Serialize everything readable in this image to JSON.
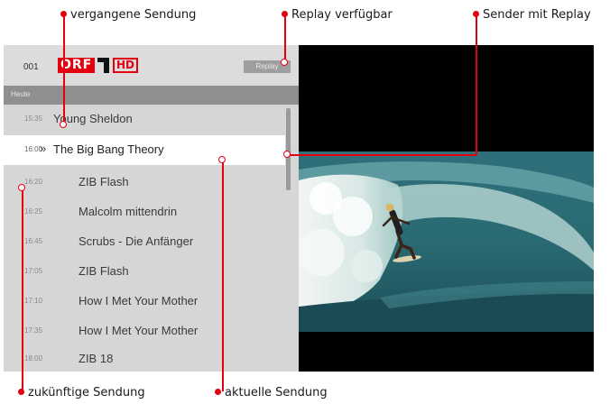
{
  "annotations": {
    "past": "vergangene Sendung",
    "replay": "Replay verfügbar",
    "channel_replay": "Sender mit Replay",
    "future": "zukünftige Sendung",
    "current": "aktuelle Sendung"
  },
  "channel": {
    "number": "001",
    "logo_text": "ORF",
    "hd_text": "HD",
    "replay_label": "Replay"
  },
  "day_label": "Heute",
  "programs": [
    {
      "time": "15:35",
      "title": "Young Sheldon"
    },
    {
      "time": "16:00",
      "title": "The Big Bang Theory"
    },
    {
      "time": "16:20",
      "title": "ZIB Flash"
    },
    {
      "time": "16:25",
      "title": "Malcolm mittendrin"
    },
    {
      "time": "16:45",
      "title": "Scrubs - Die Anfänger"
    },
    {
      "time": "17:05",
      "title": "ZIB Flash"
    },
    {
      "time": "17:10",
      "title": "How I Met Your Mother"
    },
    {
      "time": "17:35",
      "title": "How I Met Your Mother"
    },
    {
      "time": "18:00",
      "title": "ZIB 18"
    }
  ],
  "colors": {
    "accent": "#e3000f",
    "panel": "#d6d6d6",
    "current_row": "#ffffff"
  }
}
